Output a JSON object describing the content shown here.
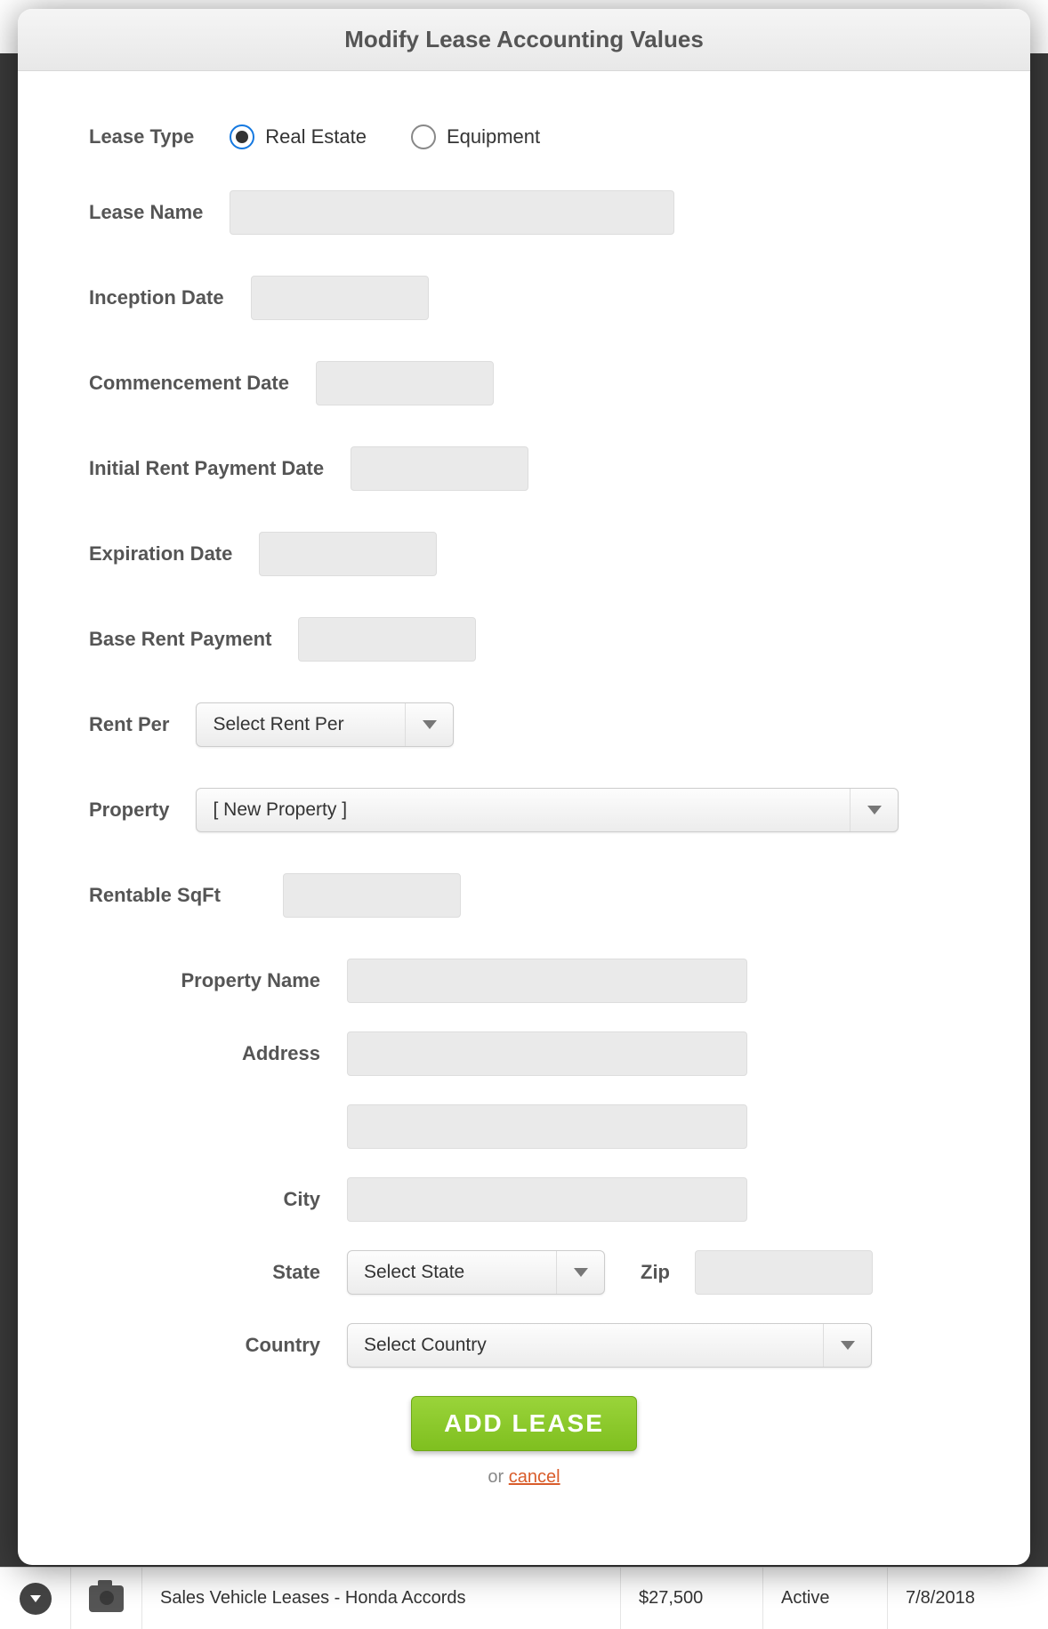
{
  "modal": {
    "title": "Modify Lease Accounting Values",
    "fields": {
      "leaseType": {
        "label": "Lease Type",
        "options": {
          "realEstate": "Real Estate",
          "equipment": "Equipment"
        },
        "selected": "realEstate"
      },
      "leaseName": {
        "label": "Lease Name",
        "value": ""
      },
      "inceptionDate": {
        "label": "Inception Date",
        "value": ""
      },
      "commencementDate": {
        "label": "Commencement Date",
        "value": ""
      },
      "initialRentPaymentDate": {
        "label": "Initial Rent Payment Date",
        "value": ""
      },
      "expirationDate": {
        "label": "Expiration Date",
        "value": ""
      },
      "baseRentPayment": {
        "label": "Base Rent Payment",
        "value": ""
      },
      "rentPer": {
        "label": "Rent Per",
        "selected": "Select Rent Per"
      },
      "property": {
        "label": "Property",
        "selected": "[ New Property ]"
      },
      "rentableSqft": {
        "label": "Rentable SqFt",
        "value": ""
      },
      "propertyName": {
        "label": "Property Name",
        "value": ""
      },
      "address": {
        "label": "Address",
        "value": ""
      },
      "address2": {
        "value": ""
      },
      "city": {
        "label": "City",
        "value": ""
      },
      "state": {
        "label": "State",
        "selected": "Select State"
      },
      "zip": {
        "label": "Zip",
        "value": ""
      },
      "country": {
        "label": "Country",
        "selected": "Select Country"
      }
    },
    "footer": {
      "submit": "ADD LEASE",
      "or": "or ",
      "cancel": "cancel"
    }
  },
  "background": {
    "row": {
      "name": "Sales Vehicle Leases - Honda Accords",
      "amount": "$27,500",
      "status": "Active",
      "date": "7/8/2018"
    }
  }
}
